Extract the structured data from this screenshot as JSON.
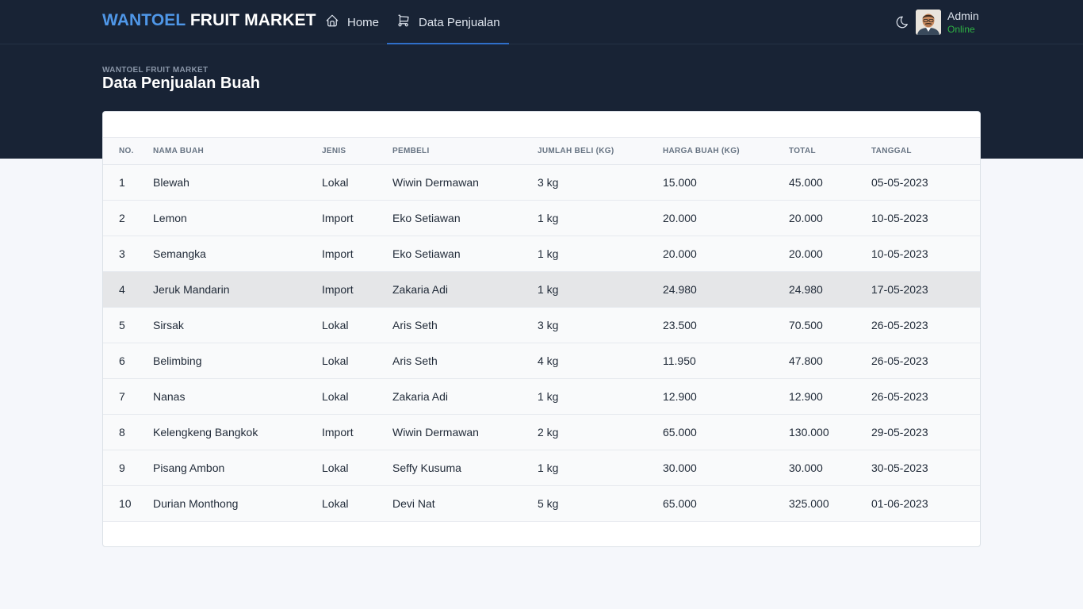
{
  "brand": {
    "part1": "WANTOEL",
    "part2": "FRUIT MARKET"
  },
  "nav": {
    "home_label": "Home",
    "sales_label": "Data Penjualan",
    "active": "Data Penjualan"
  },
  "user": {
    "name": "Admin",
    "status": "Online"
  },
  "page": {
    "pretitle": "WANTOEL FRUIT MARKET",
    "title": "Data Penjualan Buah"
  },
  "table": {
    "headers": [
      "NO.",
      "NAMA BUAH",
      "JENIS",
      "PEMBELI",
      "JUMLAH BELI (KG)",
      "HARGA BUAH (KG)",
      "TOTAL",
      "TANGGAL"
    ],
    "rows": [
      [
        "1",
        "Blewah",
        "Lokal",
        "Wiwin Dermawan",
        "3 kg",
        "15.000",
        "45.000",
        "05-05-2023"
      ],
      [
        "2",
        "Lemon",
        "Import",
        "Eko Setiawan",
        "1 kg",
        "20.000",
        "20.000",
        "10-05-2023"
      ],
      [
        "3",
        "Semangka",
        "Import",
        "Eko Setiawan",
        "1 kg",
        "20.000",
        "20.000",
        "10-05-2023"
      ],
      [
        "4",
        "Jeruk Mandarin",
        "Import",
        "Zakaria Adi",
        "1 kg",
        "24.980",
        "24.980",
        "17-05-2023"
      ],
      [
        "5",
        "Sirsak",
        "Lokal",
        "Aris Seth",
        "3 kg",
        "23.500",
        "70.500",
        "26-05-2023"
      ],
      [
        "6",
        "Belimbing",
        "Lokal",
        "Aris Seth",
        "4 kg",
        "11.950",
        "47.800",
        "26-05-2023"
      ],
      [
        "7",
        "Nanas",
        "Lokal",
        "Zakaria Adi",
        "1 kg",
        "12.900",
        "12.900",
        "26-05-2023"
      ],
      [
        "8",
        "Kelengkeng Bangkok",
        "Import",
        "Wiwin Dermawan",
        "2 kg",
        "65.000",
        "130.000",
        "29-05-2023"
      ],
      [
        "9",
        "Pisang Ambon",
        "Lokal",
        "Seffy Kusuma",
        "1 kg",
        "30.000",
        "30.000",
        "30-05-2023"
      ],
      [
        "10",
        "Durian Monthong",
        "Lokal",
        "Devi Nat",
        "5 kg",
        "65.000",
        "325.000",
        "01-06-2023"
      ]
    ],
    "hovered_row": "4"
  },
  "icons": {
    "home": "home-icon",
    "cart": "cart-icon",
    "theme": "moon-icon"
  },
  "colors": {
    "navbar_bg": "#182335",
    "brand_accent": "#4f97e8",
    "status_online": "#2fb344",
    "active_underline": "#2f6fca"
  }
}
